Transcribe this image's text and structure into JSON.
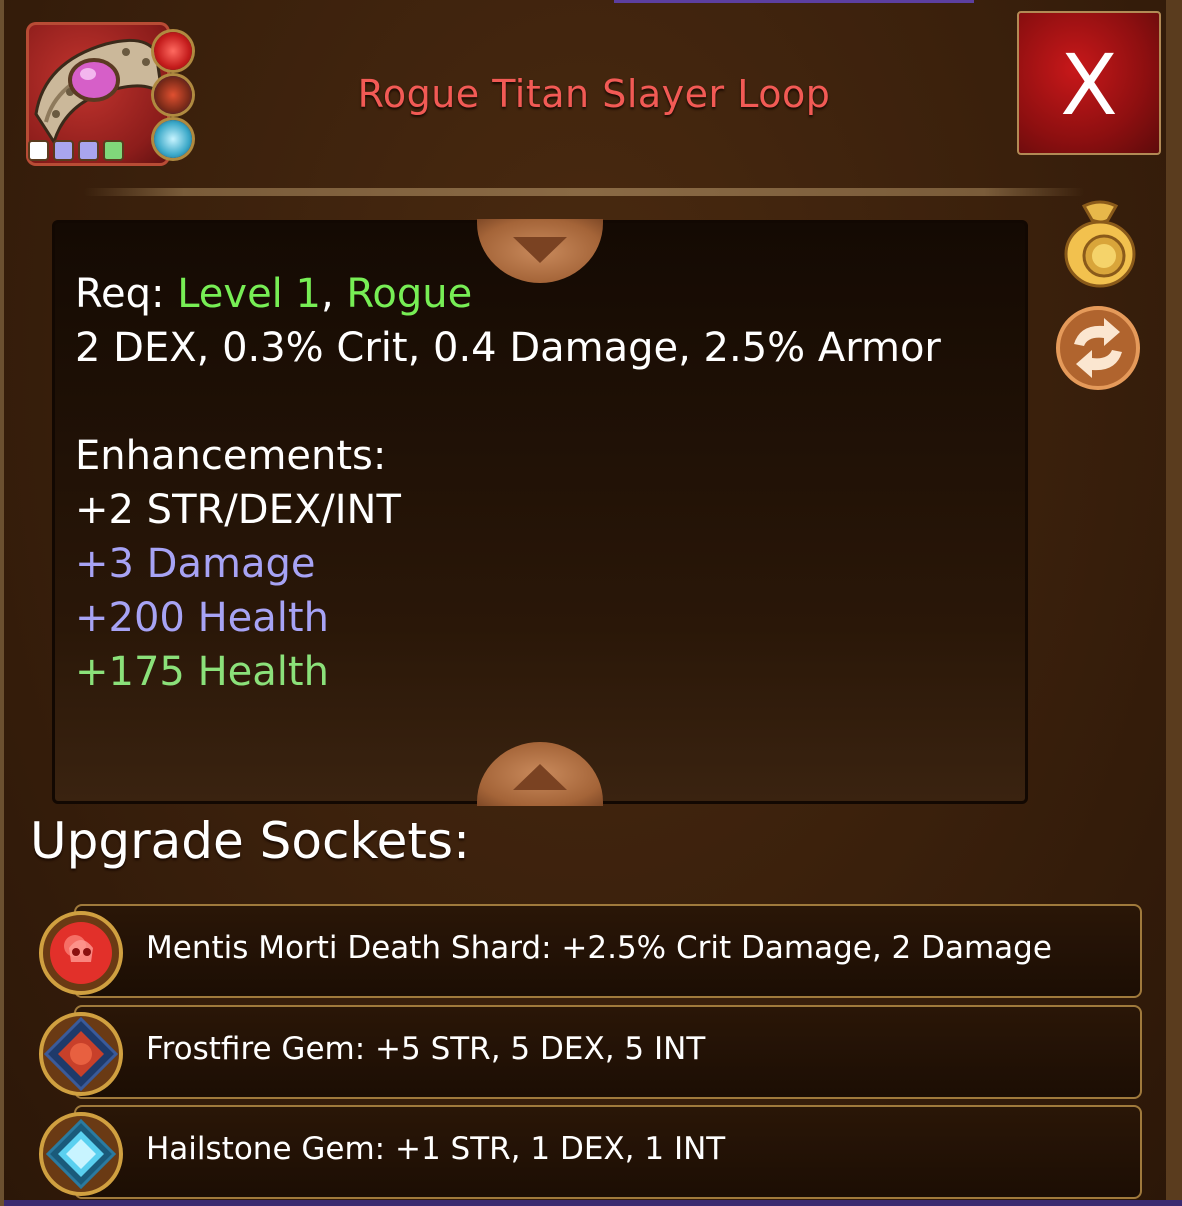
{
  "item": {
    "title": "Rogue Titan Slayer Loop",
    "icon_name": "bracer-ring-icon",
    "quality_colors": [
      "#ffffff",
      "#a9a5ee",
      "#a9a5ee",
      "#80d77a"
    ]
  },
  "close_button": {
    "label": "X"
  },
  "side_icons": [
    "money-bag-icon",
    "swap-icon"
  ],
  "description": {
    "req_label": "Req:",
    "req_level": "Level 1",
    "req_sep": ",",
    "req_class": "Rogue",
    "base_stats": "2 DEX, 0.3% Crit, 0.4 Damage, 2.5% Armor",
    "enh_header": "Enhancements:",
    "enh_1": "+2 STR/DEX/INT",
    "enh_2": "+3 Damage",
    "enh_3": "+200 Health",
    "enh_4": "+175 Health"
  },
  "sockets": {
    "heading": "Upgrade Sockets:",
    "items": [
      {
        "text": "Mentis Morti Death Shard: +2.5% Crit Damage, 2 Damage",
        "icon": "red-skull-gem-icon"
      },
      {
        "text": "Frostfire Gem: +5 STR, 5 DEX, 5 INT",
        "icon": "frostfire-gem-icon"
      },
      {
        "text": "Hailstone Gem: +1 STR, 1 DEX, 1 INT",
        "icon": "hailstone-gem-icon"
      }
    ]
  },
  "colors": {
    "title": "#f25a55",
    "requirement": "#77ee55",
    "enhance_purple": "#a7a3f5",
    "enhance_green": "#8be17a"
  }
}
